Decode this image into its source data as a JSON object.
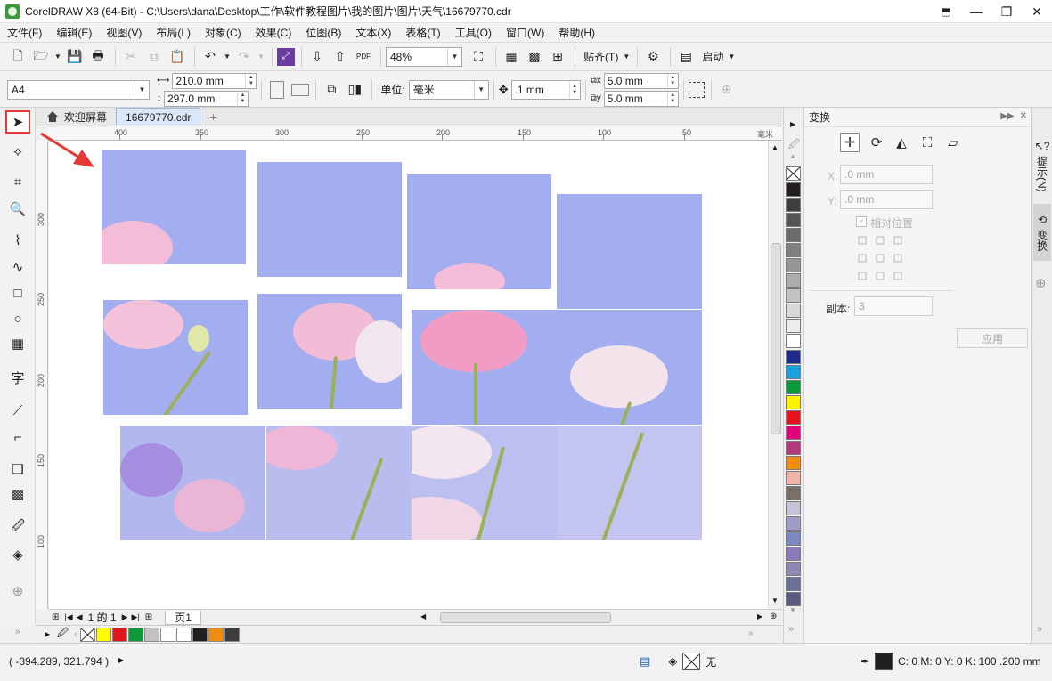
{
  "window": {
    "title": "CorelDRAW X8 (64-Bit) - C:\\Users\\dana\\Desktop\\工作\\软件教程图片\\我的图片\\图片\\天气\\16679770.cdr",
    "minimize": "—",
    "restore": "❐",
    "close": "✕"
  },
  "menu": [
    "文件(F)",
    "编辑(E)",
    "视图(V)",
    "布局(L)",
    "对象(C)",
    "效果(C)",
    "位图(B)",
    "文本(X)",
    "表格(T)",
    "工具(O)",
    "窗口(W)",
    "帮助(H)"
  ],
  "toolbar1": {
    "zoom": "48%",
    "snap": "贴齐(T)",
    "launch": "启动"
  },
  "toolbar2": {
    "paper_size": "A4",
    "width": "210.0 mm",
    "height": "297.0 mm",
    "units_label": "单位:",
    "units": "毫米",
    "nudge": ".1 mm",
    "dup_x": "5.0 mm",
    "dup_y": "5.0 mm"
  },
  "tabs": {
    "welcome": "欢迎屏幕",
    "document": "16679770.cdr",
    "add": "+"
  },
  "ruler_h": [
    "400",
    "350",
    "300",
    "250",
    "200",
    "150",
    "100",
    "50",
    "毫米"
  ],
  "ruler_v": [
    "300",
    "250",
    "200",
    "150",
    "100"
  ],
  "page_nav": {
    "of_text": "1 的 1",
    "page_tab": "页1"
  },
  "docker": {
    "title": "变换",
    "x_label": "X:",
    "x_value": ".0 mm",
    "y_label": "Y:",
    "y_value": ".0 mm",
    "relative": "相对位置",
    "copies_label": "副本:",
    "copies_value": "3",
    "apply": "应用"
  },
  "docker_tabs": {
    "hints": "提示(N)",
    "transform": "变换"
  },
  "status": {
    "coords": "( -394.289, 321.794 )",
    "fill": "无",
    "outline": "C: 0 M: 0 Y: 0 K: 100  .200 mm"
  },
  "colors": {
    "accent": "#e53935",
    "sky": "#a3aef0",
    "palette": [
      "#231f20",
      "#3d3d3d",
      "#555555",
      "#6b6b6b",
      "#808080",
      "#969696",
      "#acacac",
      "#c2c2c2",
      "#d8d8d8",
      "#ececec",
      "#ffffff",
      "#1e2a8a",
      "#1aa0e0",
      "#0a9a3a",
      "#fff200",
      "#e3141e",
      "#e0007a",
      "#b03a7a",
      "#f28c10",
      "#f0b4a8",
      "#7a6e66",
      "#c6c2d8",
      "#9e9cc8",
      "#7e88c0",
      "#8a7ab8",
      "#8e88b6",
      "#6a6f98",
      "#5a5b80"
    ],
    "doc_palette": [
      "#ffff00",
      "#e3141e",
      "#0a9a3a",
      "#c2c2c2",
      "#ffffff",
      "#ffffff",
      "#231f20",
      "#f28c10",
      "#3d3d3d"
    ]
  }
}
